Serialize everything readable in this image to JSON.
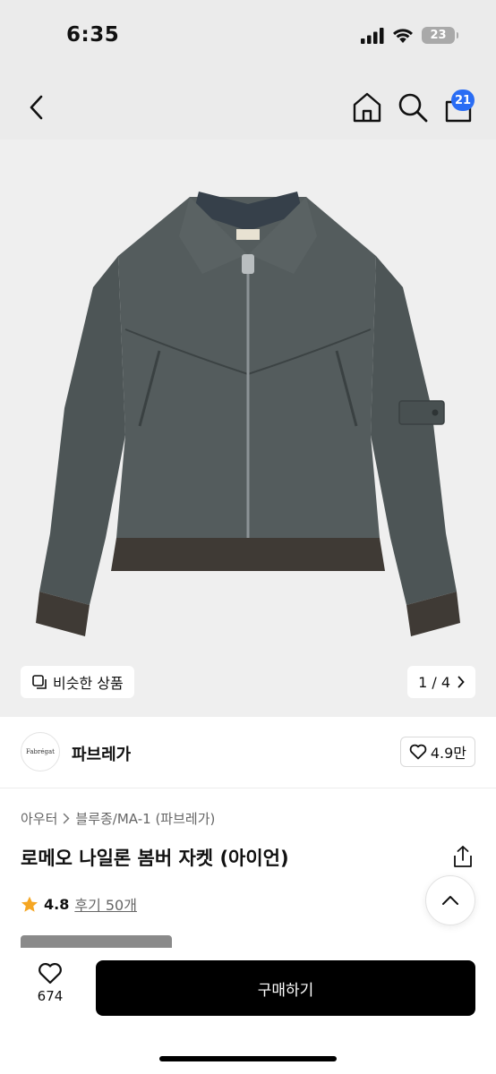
{
  "status": {
    "time": "6:35",
    "battery": "23"
  },
  "nav": {
    "cart_count": "21",
    "icons": [
      "back-icon",
      "home-icon",
      "search-icon",
      "bag-icon"
    ]
  },
  "gallery": {
    "similar_label": "비슷한 상품",
    "page": "1 / 4"
  },
  "brand": {
    "logo_text": "Fabrégat",
    "name": "파브레가",
    "likes": "4.9만"
  },
  "product": {
    "breadcrumb": [
      "아우터",
      "블루종/MA-1 (파브레가)"
    ],
    "title": "로메오 나일론 봄버 자켓 (아이언)",
    "rating": "4.8",
    "reviews": "후기 50개"
  },
  "bottom": {
    "like_count": "674",
    "buy_label": "구매하기"
  },
  "colors": {
    "accent": "#2a6df4",
    "star": "#f5a623",
    "jacket": "#4d5556"
  }
}
